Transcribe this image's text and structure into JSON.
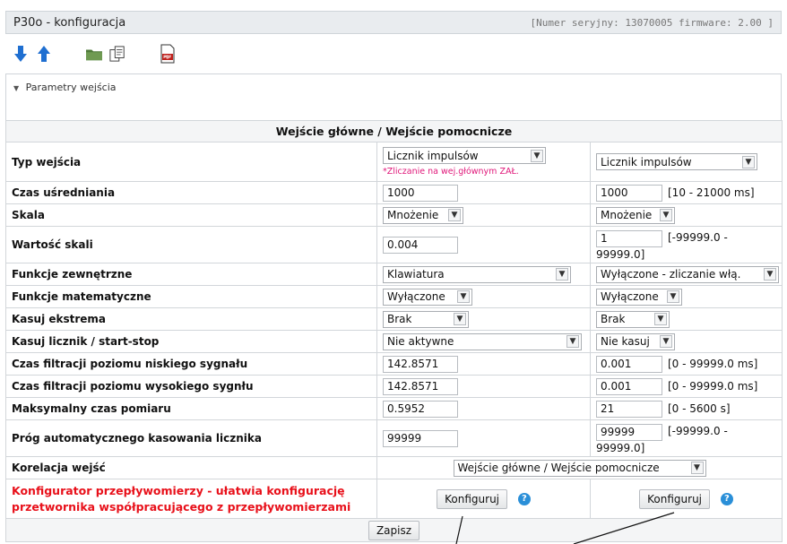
{
  "window": {
    "title": "P30o - konfiguracja",
    "serial": "[Numer seryjny: 13070005 firmware: 2.00 ]"
  },
  "toolbar": {
    "icons": [
      "arrow-down-icon",
      "arrow-up-icon",
      "folder-icon",
      "copy-icon",
      "pdf-icon"
    ]
  },
  "panel": {
    "title": "Parametry wejścia"
  },
  "table": {
    "header": "Wejście główne / Wejście pomocnicze",
    "rows": {
      "typ": {
        "label": "Typ wejścia",
        "main": "Licznik impulsów",
        "hint": "*Zliczanie na wej.głównym ZAŁ.",
        "aux": "Licznik impulsów"
      },
      "czas_usr": {
        "label": "Czas uśredniania",
        "main": "1000",
        "aux": "1000",
        "range": "[10 - 21000 ms]"
      },
      "skala": {
        "label": "Skala",
        "main": "Mnożenie",
        "aux": "Mnożenie"
      },
      "wartosc": {
        "label": "Wartość skali",
        "main": "0.004",
        "aux": "1",
        "range": "[-99999.0 -",
        "range2": "99999.0]"
      },
      "funk_zew": {
        "label": "Funkcje zewnętrzne",
        "main": "Klawiatura",
        "aux": "Wyłączone - zliczanie włą."
      },
      "funk_mat": {
        "label": "Funkcje matematyczne",
        "main": "Wyłączone",
        "aux": "Wyłączone"
      },
      "ekstrema": {
        "label": "Kasuj ekstrema",
        "main": "Brak",
        "aux": "Brak"
      },
      "licznik": {
        "label": "Kasuj licznik / start-stop",
        "main": "Nie aktywne",
        "aux": "Nie kasuj"
      },
      "filtr_nis": {
        "label": "Czas filtracji poziomu niskiego sygnału",
        "main": "142.8571",
        "aux": "0.001",
        "range": "[0 - 99999.0 ms]"
      },
      "filtr_wys": {
        "label": "Czas filtracji poziomu wysokiego sygnłu",
        "main": "142.8571",
        "aux": "0.001",
        "range": "[0 - 99999.0 ms]"
      },
      "maks": {
        "label": "Maksymalny czas pomiaru",
        "main": "0.5952",
        "aux": "21",
        "range": "[0 - 5600 s]"
      },
      "prog": {
        "label": "Próg automatycznego kasowania licznika",
        "main": "99999",
        "aux": "99999",
        "aux2": "99999.0]",
        "range": "[-99999.0 -"
      },
      "korelacja": {
        "label": "Korelacja wejść",
        "value": "Wejście główne / Wejście pomocnicze"
      },
      "konfigurator": {
        "label": "Konfigurator przepływomierzy - ułatwia konfigurację przetwornika współpracującego z przepływomierzami",
        "button": "Konfiguruj",
        "info": "?"
      }
    },
    "save": "Zapisz"
  },
  "colors": {
    "accent": "#2a8fd8",
    "hint": "#e0187a",
    "warning": "#e8101a"
  }
}
